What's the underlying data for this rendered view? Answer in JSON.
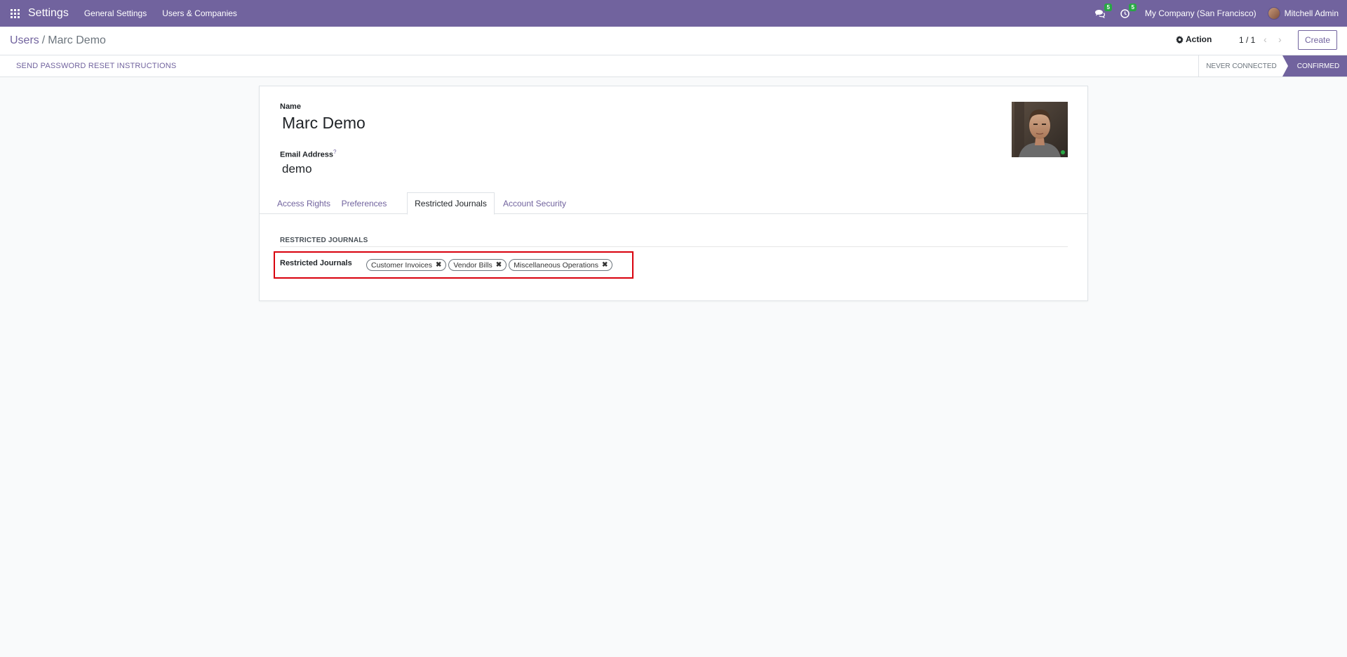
{
  "navbar": {
    "app_name": "Settings",
    "menus": [
      "General Settings",
      "Users & Companies"
    ],
    "messages_count": "5",
    "activities_count": "5",
    "company": "My Company (San Francisco)",
    "user": "Mitchell Admin"
  },
  "control_panel": {
    "breadcrumb_parent": "Users",
    "breadcrumb_separator": "/",
    "breadcrumb_current": "Marc Demo",
    "action_label": "Action",
    "pager": "1 / 1",
    "create_label": "Create"
  },
  "statusbar": {
    "reset_label": "SEND PASSWORD RESET INSTRUCTIONS",
    "status_never": "NEVER CONNECTED",
    "status_confirmed": "CONFIRMED"
  },
  "form": {
    "name_label": "Name",
    "name_value": "Marc Demo",
    "email_label": "Email Address",
    "email_help": "?",
    "email_value": "demo",
    "tabs": [
      "Access Rights",
      "Preferences",
      "Restricted Journals",
      "Account Security"
    ],
    "active_tab": "Restricted Journals",
    "section_title": "RESTRICTED JOURNALS",
    "field_label": "Restricted Journals",
    "tags": [
      "Customer Invoices",
      "Vendor Bills",
      "Miscellaneous Operations"
    ]
  },
  "colors": {
    "brand": "#71639e",
    "highlight": "#d9000d",
    "badge": "#28a745"
  }
}
